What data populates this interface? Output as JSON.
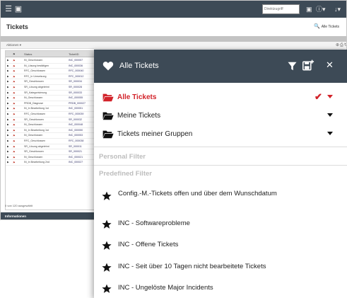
{
  "topbar": {
    "search_placeholder": "Direktzugriff",
    "user_menu": "↓▾",
    "help_menu": "ⓘ▾"
  },
  "page": {
    "title": "Tickets",
    "all_tickets_button": "Alle Tickets",
    "actions_label": "Aktionen ▾",
    "info_label": "Informationen",
    "grid_footer": "0 von 120 ausgewählt"
  },
  "grid": {
    "columns": [
      "Status",
      "TicketID"
    ],
    "rows": [
      {
        "status": "IN_Geschlossen",
        "id": "INC_000057"
      },
      {
        "status": "IN_Lösung bestätigen",
        "id": "INC_000036"
      },
      {
        "status": "RFC_Geschlossen",
        "id": "RFC_000040"
      },
      {
        "status": "RFC_In Umsetzung",
        "id": "RFC_000012"
      },
      {
        "status": "SR_Geschlossen",
        "id": "SR_000034"
      },
      {
        "status": "SR_Lösung abgelehnt",
        "id": "SR_000028"
      },
      {
        "status": "SR_Kategorisierung",
        "id": "SR_000033"
      },
      {
        "status": "IN_Geschlossen",
        "id": "INC_000055"
      },
      {
        "status": "PRDB_Diagnose",
        "id": "PRDB_000027"
      },
      {
        "status": "IN_In Bearbeitung 1st",
        "id": "INC_000051"
      },
      {
        "status": "RFC_Geschlossen",
        "id": "RFC_000039"
      },
      {
        "status": "SR_Geschlossen",
        "id": "SR_000032"
      },
      {
        "status": "IN_Geschlossen",
        "id": "INC_000048"
      },
      {
        "status": "IN_In Bearbeitung 1st",
        "id": "INC_000050"
      },
      {
        "status": "IN_Geschlossen",
        "id": "INC_000053"
      },
      {
        "status": "RFC_Geschlossen",
        "id": "RFC_000038"
      },
      {
        "status": "SR_Lösung abgelehnt",
        "id": "SR_000011"
      },
      {
        "status": "SR_Geschlossen",
        "id": "SR_000021"
      },
      {
        "status": "IN_Geschlossen",
        "id": "INC_000021"
      },
      {
        "status": "IN_In Bearbeitung 2nd",
        "id": "INC_000027"
      }
    ]
  },
  "panel": {
    "title": "Alle Tickets",
    "groups": [
      {
        "label": "Alle Tickets",
        "active": true
      },
      {
        "label": "Meine Tickets",
        "active": false
      },
      {
        "label": "Tickets meiner Gruppen",
        "active": false
      }
    ],
    "personal_filter_label": "Personal Filter",
    "predefined_filter_label": "Predefined Filter",
    "predefined_filters": [
      {
        "label": "Config.-M.-Tickets offen und über dem Wunschdatum"
      },
      {
        "label": "INC - Softwareprobleme"
      },
      {
        "label": "INC - Offene Tickets"
      },
      {
        "label": "INC - Seit über 10 Tagen nicht bearbeitete Tickets"
      },
      {
        "label": "INC - Ungelöste Major Incidents"
      }
    ]
  },
  "colors": {
    "header_bg": "#3d4a56",
    "accent_red": "#d2232a",
    "section_grey": "#bdbdbd"
  }
}
